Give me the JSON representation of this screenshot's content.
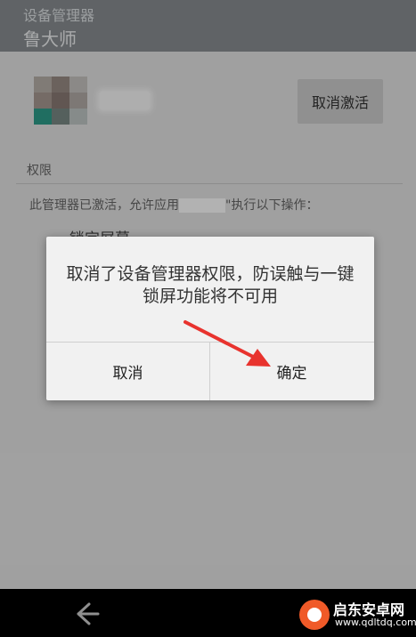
{
  "header": {
    "subtitle": "设备管理器",
    "title": "鲁大师"
  },
  "app": {
    "deactivate_label": "取消激活"
  },
  "permissions": {
    "section_label": "权限",
    "description_prefix": "此管理器已激活，允许应用",
    "description_suffix": "\"执行以下操作：",
    "first_item": "锁定屏幕"
  },
  "dialog": {
    "message": "取消了设备管理器权限，防误触与一键锁屏功能将不可用",
    "cancel_label": "取消",
    "confirm_label": "确定"
  },
  "watermark": {
    "name": "启东安卓网",
    "url": "www.qdltdq.com"
  },
  "colors": {
    "header_bg": "#8a8f92",
    "annotation_arrow": "#e8332e",
    "watermark_logo": "#f05a28"
  },
  "icons": {
    "back": "back-arrow-icon"
  }
}
